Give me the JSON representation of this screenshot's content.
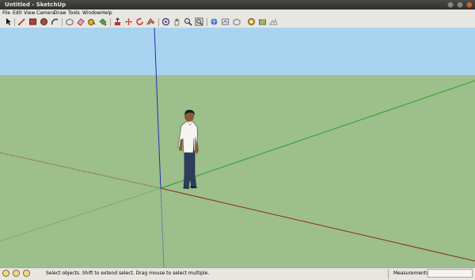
{
  "window": {
    "title": "Untitled - SketchUp"
  },
  "menu": [
    "File",
    "Edit",
    "View",
    "Camera",
    "Draw",
    "Tools",
    "Window",
    "Help"
  ],
  "toolbar": {
    "tools": [
      "select-tool",
      "line-tool",
      "rectangle-tool",
      "circle-tool",
      "arc-tool",
      "make-component-tool",
      "eraser-tool",
      "tape-measure-tool",
      "paint-bucket-tool",
      "push-pull-tool",
      "move-tool",
      "rotate-tool",
      "offset-tool",
      "orbit-tool",
      "pan-tool",
      "zoom-tool",
      "zoom-extents-tool",
      "get-models-tool",
      "share-model-tool",
      "share-component-tool",
      "extension-warehouse-tool",
      "add-location-tool",
      "toggle-terrain-tool"
    ]
  },
  "viewport": {
    "sky_color": "#a9d4ef",
    "ground_color": "#9cbf8c",
    "axis_colors": {
      "red": "#8b2a1e",
      "green": "#27a02a",
      "blue": "#2c2ca8"
    }
  },
  "status": {
    "message": "Select objects. Shift to extend select. Drag mouse to select multiple.",
    "measurements_label": "Measurements",
    "measurements_value": ""
  }
}
